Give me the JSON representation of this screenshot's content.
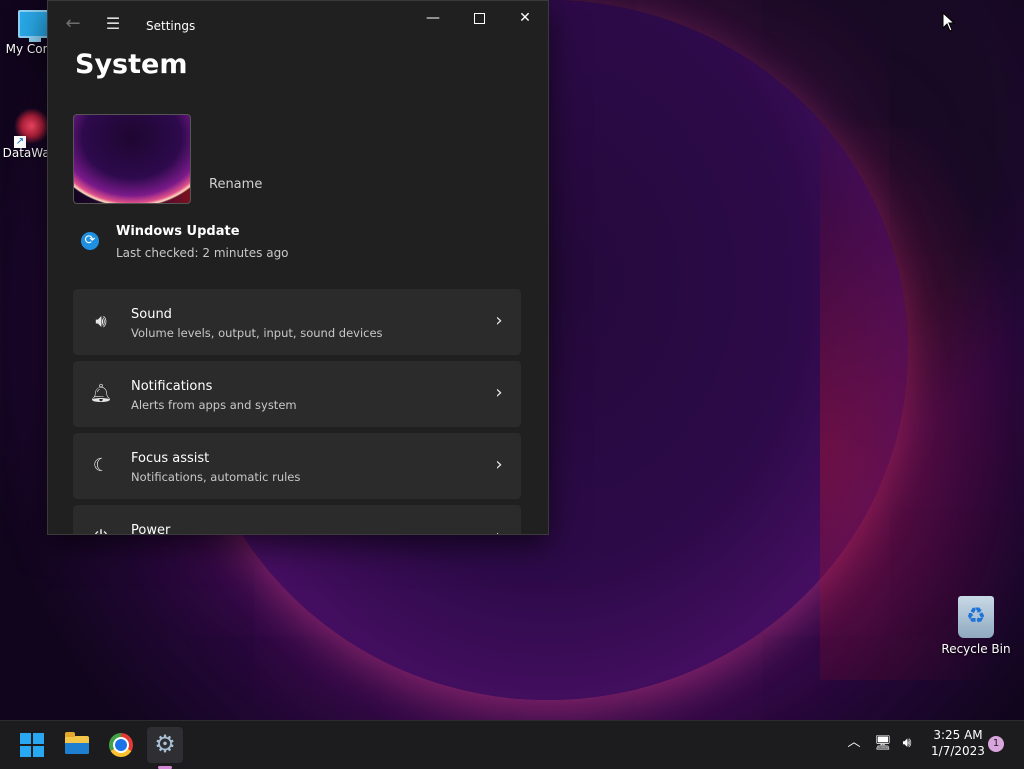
{
  "desktop": {
    "icons": [
      {
        "label": "My Com"
      },
      {
        "label": "DataWag"
      },
      {
        "label": "Recycle Bin"
      }
    ]
  },
  "window": {
    "title": "Settings",
    "page_title": "System",
    "rename_label": "Rename",
    "windows_update": {
      "title": "Windows Update",
      "subtitle": "Last checked: 2 minutes ago"
    },
    "cards": [
      {
        "icon": "speaker-icon",
        "title": "Sound",
        "subtitle": "Volume levels, output, input, sound devices"
      },
      {
        "icon": "bell-icon",
        "title": "Notifications",
        "subtitle": "Alerts from apps and system"
      },
      {
        "icon": "moon-icon",
        "title": "Focus assist",
        "subtitle": "Notifications, automatic rules"
      },
      {
        "icon": "power-icon",
        "title": "Power",
        "subtitle": ""
      }
    ]
  },
  "taskbar": {
    "apps": [
      {
        "icon": "windows-start-icon"
      },
      {
        "icon": "file-explorer-icon"
      },
      {
        "icon": "chrome-icon"
      },
      {
        "icon": "settings-gear-icon"
      }
    ],
    "clock": {
      "time": "3:25 AM",
      "date": "1/7/2023"
    },
    "notification_count": "1"
  },
  "colors": {
    "window_bg": "#202020",
    "card_bg": "#2b2b2b",
    "accent": "#1f8fe0",
    "taskbar_bg": "#1c1c1e"
  }
}
